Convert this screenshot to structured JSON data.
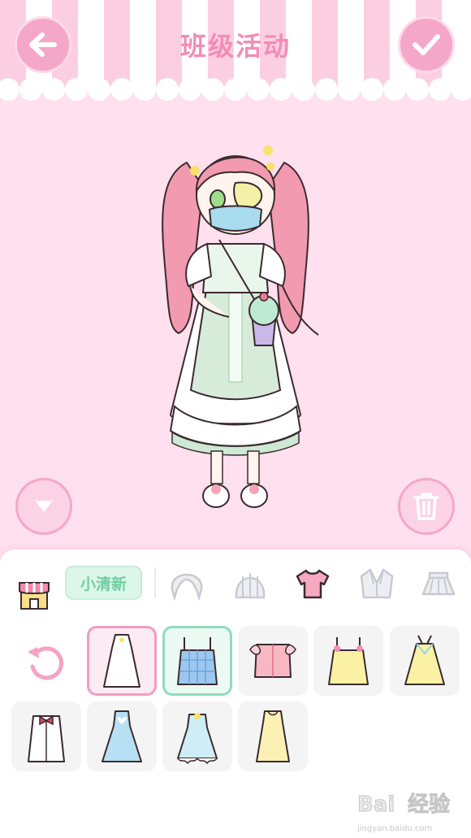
{
  "header": {
    "title": "班级活动",
    "back_icon": "arrow-left-icon",
    "confirm_icon": "checkmark-icon"
  },
  "stage": {
    "collapse_icon": "chevron-down-icon",
    "delete_icon": "trash-icon",
    "colors": {
      "background": "#ffe0ee",
      "accent": "#f5a7c9",
      "title": "#f28db8"
    }
  },
  "categories": {
    "shop_icon": "shop-icon",
    "filter_pill": "小清新",
    "items": [
      {
        "name": "hair-front-icon",
        "selected": false
      },
      {
        "name": "hair-back-icon",
        "selected": false
      },
      {
        "name": "top-shirt-icon",
        "selected": true
      },
      {
        "name": "jacket-icon",
        "selected": false
      },
      {
        "name": "skirt-icon",
        "selected": false
      }
    ]
  },
  "wardrobe": {
    "undo_icon": "undo-icon",
    "items": [
      {
        "name": "white-dress-item",
        "selected": true
      },
      {
        "name": "blue-plaid-camisole-item",
        "selected": true
      },
      {
        "name": "pink-frill-top-item",
        "selected": false
      },
      {
        "name": "yellow-camisole-item",
        "selected": false
      },
      {
        "name": "yellow-slip-dress-item",
        "selected": false
      },
      {
        "name": "white-bow-blouse-item",
        "selected": false
      },
      {
        "name": "blue-heart-dress-item",
        "selected": false
      },
      {
        "name": "blue-lace-dress-item",
        "selected": false
      },
      {
        "name": "cream-dress-item",
        "selected": false
      }
    ]
  },
  "watermark": {
    "brand": "Bai",
    "brand_cn": "经验",
    "url": "jingyan.baidu.com"
  }
}
